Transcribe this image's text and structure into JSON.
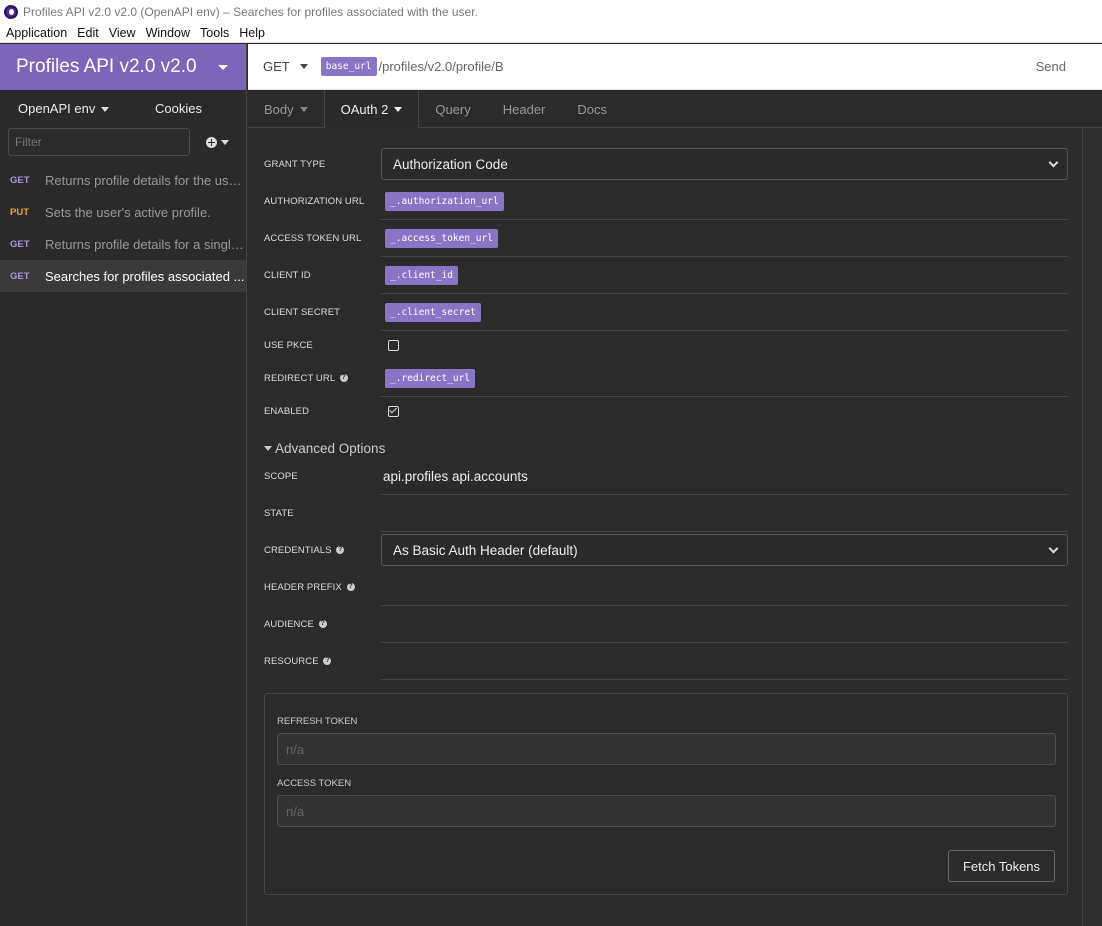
{
  "window": {
    "title": "Profiles API v2.0 v2.0 (OpenAPI env) – Searches for profiles associated with the user."
  },
  "menu": [
    "Application",
    "Edit",
    "View",
    "Window",
    "Tools",
    "Help"
  ],
  "sidebar": {
    "workspace": "Profiles API v2.0 v2.0",
    "environment": "OpenAPI env",
    "cookies": "Cookies",
    "filter_placeholder": "Filter",
    "requests": [
      {
        "method": "GET",
        "label": "Returns profile details for the use..."
      },
      {
        "method": "PUT",
        "label": "Sets the user's active profile."
      },
      {
        "method": "GET",
        "label": "Returns profile details for a single..."
      },
      {
        "method": "GET",
        "label": "Searches for profiles associated ..."
      }
    ]
  },
  "urlbar": {
    "method": "GET",
    "base_tag": "base_url",
    "path": "/profiles/v2.0/profile/B",
    "send": "Send"
  },
  "tabs": {
    "body": "Body",
    "oauth": "OAuth 2",
    "query": "Query",
    "header": "Header",
    "docs": "Docs"
  },
  "form": {
    "grant_type_label": "GRANT TYPE",
    "grant_type_value": "Authorization Code",
    "auth_url_label": "AUTHORIZATION URL",
    "auth_url_tag": "_.authorization_url",
    "token_url_label": "ACCESS TOKEN URL",
    "token_url_tag": "_.access_token_url",
    "client_id_label": "CLIENT ID",
    "client_id_tag": "_.client_id",
    "client_secret_label": "CLIENT SECRET",
    "client_secret_tag": "_.client_secret",
    "pkce_label": "USE PKCE",
    "pkce_checked": false,
    "redirect_label": "REDIRECT URL",
    "redirect_tag": "_.redirect_url",
    "enabled_label": "ENABLED",
    "enabled_checked": true,
    "advanced_label": "Advanced Options",
    "scope_label": "SCOPE",
    "scope_value": "api.profiles api.accounts",
    "state_label": "STATE",
    "credentials_label": "CREDENTIALS",
    "credentials_value": "As Basic Auth Header (default)",
    "header_prefix_label": "HEADER PREFIX",
    "audience_label": "AUDIENCE",
    "resource_label": "RESOURCE"
  },
  "tokens": {
    "refresh_label": "REFRESH TOKEN",
    "refresh_placeholder": "n/a",
    "access_label": "ACCESS TOKEN",
    "access_placeholder": "n/a",
    "fetch_button": "Fetch Tokens"
  },
  "colors": {
    "accent": "#7e65b9",
    "tag": "#8a74c6",
    "get": "#a99ad6",
    "put": "#e8a13a"
  }
}
